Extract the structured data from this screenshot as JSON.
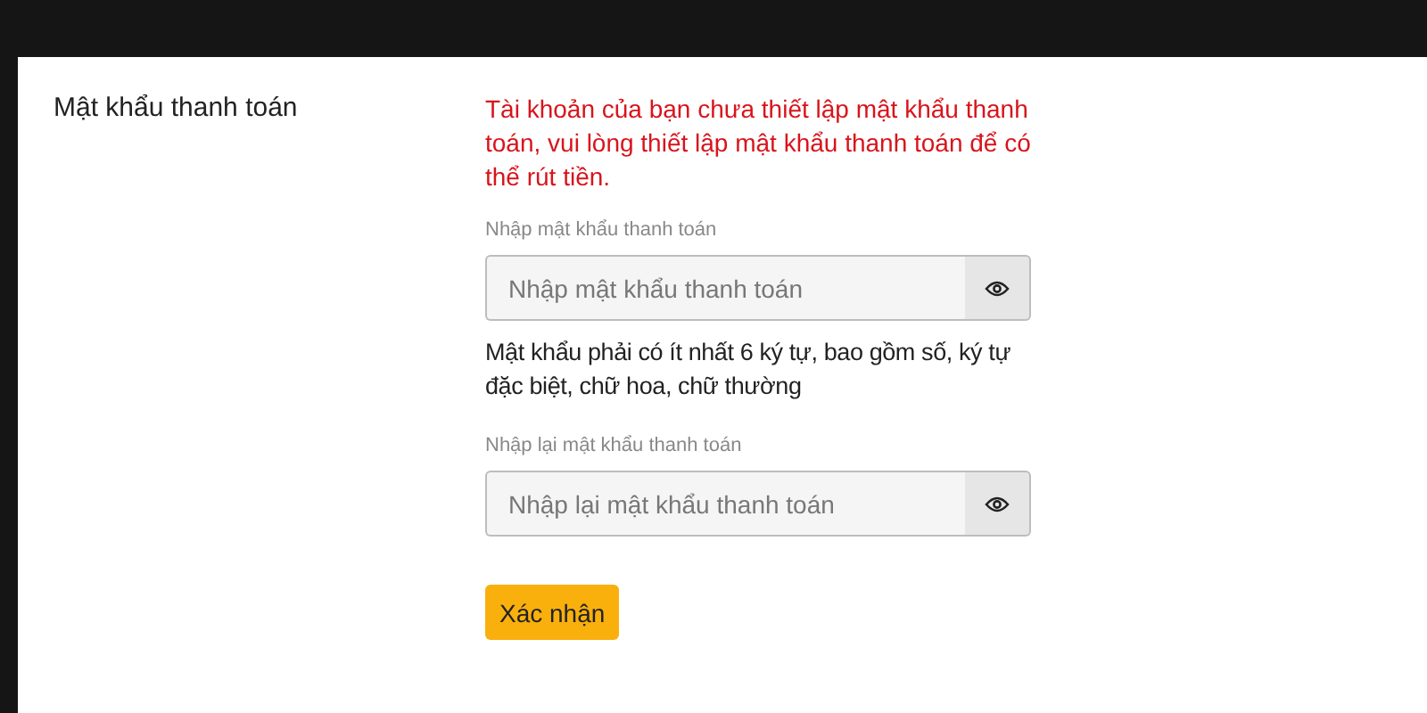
{
  "section_title": "Mật khẩu thanh toán",
  "warning": "Tài khoản của bạn chưa thiết lập mật khẩu thanh toán, vui lòng thiết lập mật khẩu thanh toán để có thể rút tiền.",
  "fields": [
    {
      "label": "Nhập mật khẩu thanh toán",
      "placeholder": "Nhập mật khẩu thanh toán",
      "hint": "Mật khẩu phải có ít nhất 6 ký tự, bao gồm số, ký tự đặc biệt, chữ hoa, chữ thường"
    },
    {
      "label": "Nhập lại mật khẩu thanh toán",
      "placeholder": "Nhập lại mật khẩu thanh toán"
    }
  ],
  "submit_button": "Xác nhận"
}
